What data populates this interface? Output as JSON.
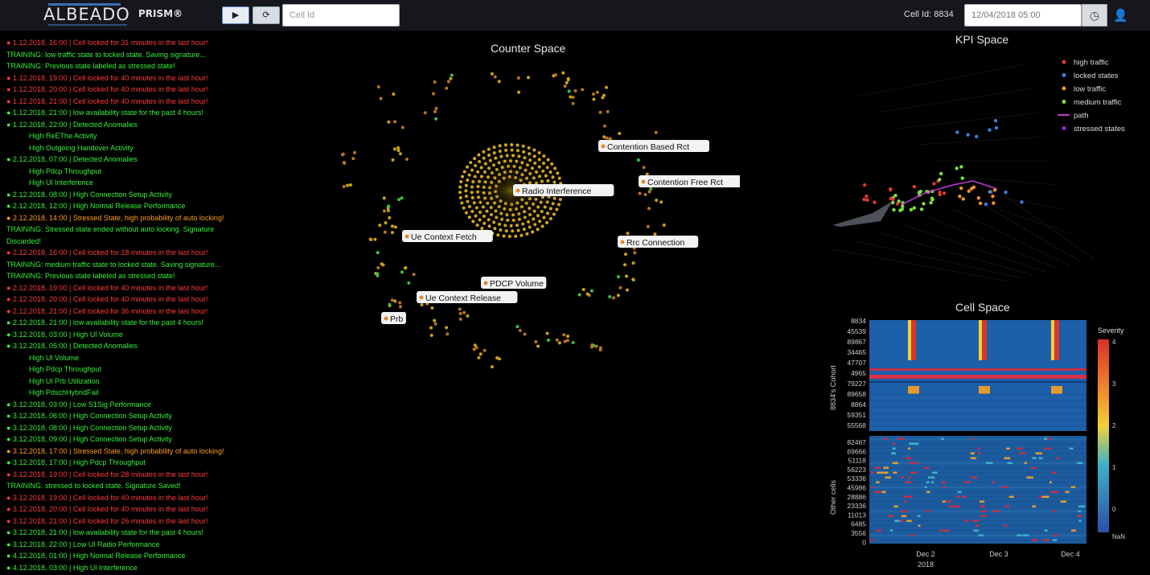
{
  "header": {
    "logo": "ALBEADO",
    "product": "PRISM®",
    "play_icon": "▶",
    "reset_icon": "⟳",
    "cellid_placeholder": "Cell Id",
    "cellid_label": "Cell Id: 8834",
    "date_value": "12/04/2018 05:00",
    "calendar_icon": "◷",
    "user_icon": "👤"
  },
  "log": [
    {
      "c": "red",
      "t": "● 1.12.2018, 16:00 | Cell locked for 31 minutes in the last hour!"
    },
    {
      "c": "green",
      "t": "TRAINING: low traffic state to locked state. Saving signature..."
    },
    {
      "c": "green",
      "t": "TRAINING: Previous state labeled as stressed state!"
    },
    {
      "c": "red",
      "t": "● 1.12.2018, 19:00 | Cell locked for 40 minutes in the last hour!"
    },
    {
      "c": "red",
      "t": "● 1.12.2018, 20:00 | Cell locked for 40 minutes in the last hour!"
    },
    {
      "c": "red",
      "t": "● 1.12.2018, 21:00 | Cell locked for 40 minutes in the last hour!"
    },
    {
      "c": "green",
      "t": "● 1.12.2018, 21:00 | low availability state for the past 4 hours!"
    },
    {
      "c": "green",
      "t": "● 1.12.2018, 22:00 | Detected Anomalies"
    },
    {
      "c": "green",
      "t": "High ReEThe Activity",
      "sub": true
    },
    {
      "c": "green",
      "t": "High Outgoing Handover Activity",
      "sub": true
    },
    {
      "c": "green",
      "t": "● 2.12.2018, 07:00 | Detected Anomalies"
    },
    {
      "c": "green",
      "t": "High Pdcp Throughput",
      "sub": true
    },
    {
      "c": "green",
      "t": "High Ul Interference",
      "sub": true
    },
    {
      "c": "green",
      "t": "● 2.12.2018, 08:00 | High Connection Setup Activity"
    },
    {
      "c": "green",
      "t": "● 2.12.2018, 12:00 | High Normal Release Performance"
    },
    {
      "c": "orange",
      "t": "● 2.12.2018, 14:00 | Stressed State, high probability of auto locking!"
    },
    {
      "c": "green",
      "t": "TRAINING: Stressed state ended without auto locking. Signature"
    },
    {
      "c": "green",
      "t": "Discarded!"
    },
    {
      "c": "red",
      "t": "● 2.12.2018, 16:00 | Cell locked for 18 minutes in the last hour!"
    },
    {
      "c": "green",
      "t": "TRAINING: medium traffic state to locked state. Saving signature..."
    },
    {
      "c": "green",
      "t": "TRAINING: Previous state labeled as stressed state!"
    },
    {
      "c": "red",
      "t": "● 2.12.2018, 19:00 | Cell locked for 40 minutes in the last hour!"
    },
    {
      "c": "red",
      "t": "● 2.12.2018, 20:00 | Cell locked for 40 minutes in the last hour!"
    },
    {
      "c": "red",
      "t": "● 2.12.2018, 21:00 | Cell locked for 36 minutes in the last hour!"
    },
    {
      "c": "green",
      "t": "● 2.12.2018, 21:00 | low availability state for the past 4 hours!"
    },
    {
      "c": "green",
      "t": "● 3.12.2018, 03:00 | High Ul Volume"
    },
    {
      "c": "green",
      "t": "● 3.12.2018, 05:00 | Detected Anomalies"
    },
    {
      "c": "green",
      "t": "High Ul Volume",
      "sub": true
    },
    {
      "c": "green",
      "t": "High Pdcp Throughput",
      "sub": true
    },
    {
      "c": "green",
      "t": "High Ul Prb Utilization",
      "sub": true
    },
    {
      "c": "green",
      "t": "High PdschHybridFail",
      "sub": true
    },
    {
      "c": "green",
      "t": "● 3.12.2018, 03:00 | Low S1Sig Performance"
    },
    {
      "c": "green",
      "t": "● 3.12.2018, 06:00 | High Connection Setup Activity"
    },
    {
      "c": "green",
      "t": "● 3.12.2018, 08:00 | High Connection Setup Activity"
    },
    {
      "c": "green",
      "t": "● 3.12.2018, 09:00 | High Connection Setup Activity"
    },
    {
      "c": "orange",
      "t": "● 3.12.2018, 17:00 | Stressed State, high probability of auto locking!"
    },
    {
      "c": "green",
      "t": "● 3.12.2018, 17:00 | High Pdcp Throughput"
    },
    {
      "c": "red",
      "t": "● 3.12.2018, 19:00 | Cell locked for 28 minutes in the last hour!"
    },
    {
      "c": "green",
      "t": "TRAINING: stressed to locked state. Signature Saved!"
    },
    {
      "c": "red",
      "t": "● 3.12.2018, 19:00 | Cell locked for 40 minutes in the last hour!"
    },
    {
      "c": "red",
      "t": "● 3.12.2018, 20:00 | Cell locked for 40 minutes in the last hour!"
    },
    {
      "c": "red",
      "t": "● 3.12.2018, 21:00 | Cell locked for 26 minutes in the last hour!"
    },
    {
      "c": "green",
      "t": "● 3.12.2018, 21:00 | low availability state for the past 4 hours!"
    },
    {
      "c": "green",
      "t": "● 3.12.2018, 22:00 | Low Ul Radio Performance"
    },
    {
      "c": "green",
      "t": "● 4.12.2018, 01:00 | High Normal Release Performance"
    },
    {
      "c": "green",
      "t": "● 4.12.2018, 03:00 | High Ul Interference"
    }
  ],
  "counter_space": {
    "title": "Counter Space",
    "node_labels": [
      "Contention Based Rct",
      "Radio Interference",
      "Contention Free Rct",
      "Ue Context Fetch",
      "Rrc Connection",
      "PDCP Volume",
      "Ue Context Release",
      "Prb"
    ]
  },
  "kpi_space": {
    "title": "KPI Space",
    "legend": [
      {
        "label": "high traffic",
        "color": "#e03a2f"
      },
      {
        "label": "locked states",
        "color": "#3c7de0"
      },
      {
        "label": "low traffic",
        "color": "#f0932a"
      },
      {
        "label": "medium traffic",
        "color": "#7ee03a"
      },
      {
        "label": "path",
        "color": "#c03ad0"
      },
      {
        "label": "stressed states",
        "color": "#8a2ad0"
      }
    ]
  },
  "cell_space": {
    "title": "Cell Space",
    "y_label_top": "8834's Cohort",
    "y_label_bottom": "Other cells",
    "top_ticks": [
      "8834",
      "45539",
      "89867",
      "34465",
      "47707",
      "4965",
      "79227",
      "89658",
      "8864",
      "59351",
      "55568"
    ],
    "bottom_ticks": [
      "82467",
      "69666",
      "51118",
      "56223",
      "53336",
      "45986",
      "28886",
      "23336",
      "11013",
      "6485",
      "3556",
      "0"
    ],
    "x_ticks": [
      "Dec 2",
      "Dec 3",
      "Dec 4"
    ],
    "x_sub": "2018",
    "colorbar_title": "Severity",
    "colorbar_ticks": [
      "4",
      "3",
      "2",
      "1",
      "0",
      "NaN"
    ]
  }
}
